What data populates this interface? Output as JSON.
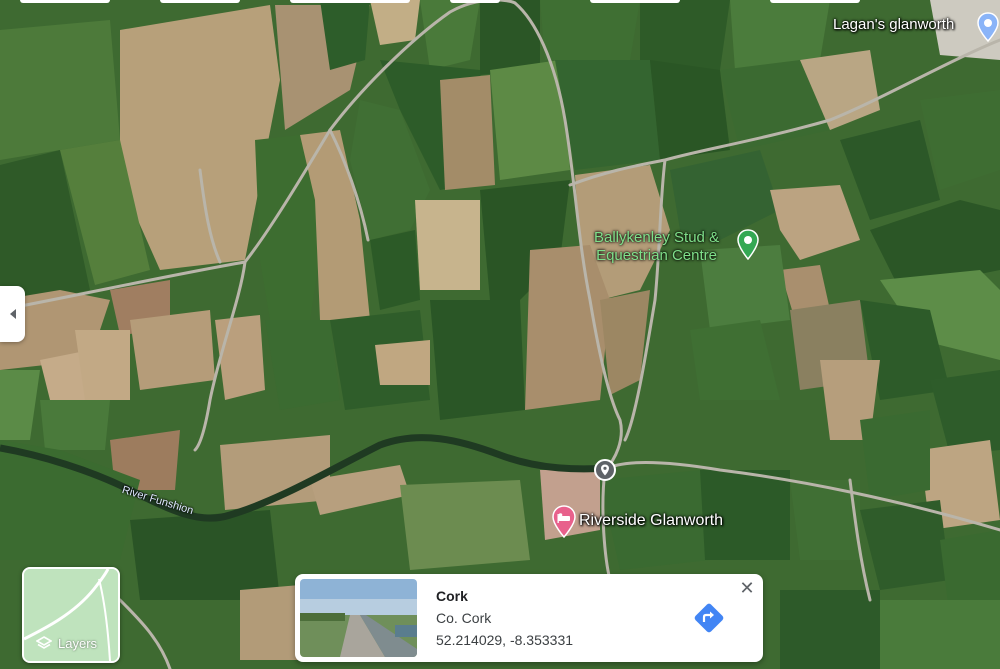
{
  "map": {
    "places": {
      "lagans": "Lagan's glanworth",
      "stud_line1": "Ballykenley Stud &",
      "stud_line2": "Equestrian Centre",
      "riverside": "Riverside Glanworth",
      "river": "River Funshion"
    }
  },
  "layers": {
    "label": "Layers"
  },
  "info_card": {
    "title": "Cork",
    "subtitle": "Co. Cork",
    "coordinates": "52.214029, -8.353331"
  },
  "icons": {
    "layers": "layers-stack-icon",
    "close": "close-icon",
    "directions": "directions-icon",
    "lodging": "bed-icon",
    "pin": "dropped-pin-icon",
    "place": "place-pin-icon",
    "collapse": "chevron-left-icon"
  },
  "colors": {
    "accent_blue": "#4285f4",
    "lodging_pin": "#e8618c",
    "place_pin_green": "#34a853",
    "place_label_green": "#7fe08a"
  }
}
